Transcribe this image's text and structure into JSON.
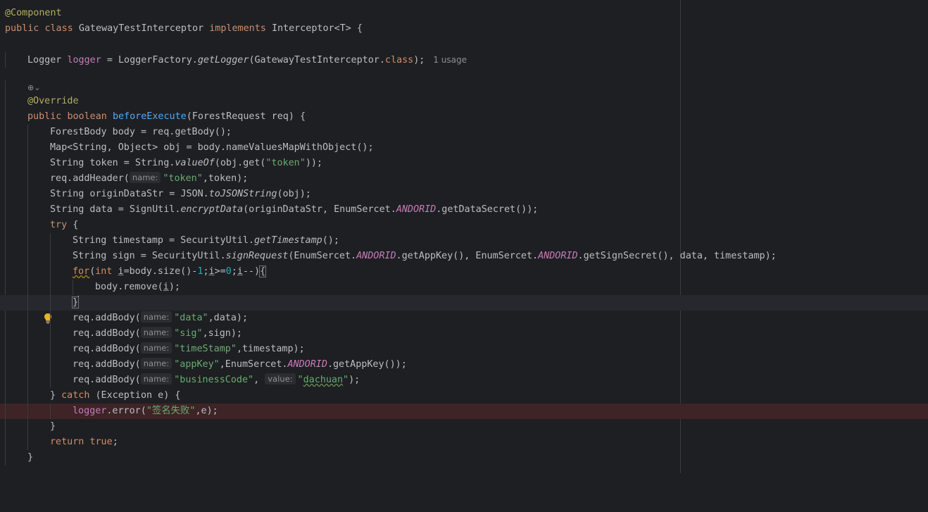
{
  "editor": {
    "annotation_component": "@Component",
    "class_decl": {
      "kw_public": "public",
      "kw_class": "class",
      "name": "GatewayTestInterceptor",
      "kw_implements": "implements",
      "iface": "Interceptor<T> {"
    },
    "logger_line": {
      "type": "Logger",
      "var": "logger",
      "eq": " = LoggerFactory.",
      "method": "getLogger",
      "arg": "(GatewayTestInterceptor.",
      "kw_class": "class",
      "end": ");",
      "usage": "1 usage"
    },
    "inherit_icon": "⊕⌄",
    "override": "@Override",
    "method_decl": {
      "kw_public": "public",
      "kw_boolean": "boolean",
      "name": "beforeExecute",
      "params": "(ForestRequest req) {"
    },
    "l_body": "ForestBody body = req.getBody();",
    "l_map": "Map<String, Object> obj = body.nameValuesMapWithObject();",
    "l_token": {
      "a": "String token = String.",
      "m": "valueOf",
      "b": "(obj.get(",
      "s": "\"token\"",
      "c": "));"
    },
    "l_header": {
      "a": "req.addHeader(",
      "hint": "name:",
      "s": "\"token\"",
      "c": ",token);"
    },
    "l_origin": {
      "a": "String originDataStr = JSON.",
      "m": "toJSONString",
      "c": "(obj);"
    },
    "l_data": {
      "a": "String data = SignUtil.",
      "m": "encryptData",
      "b": "(originDataStr, EnumSercet.",
      "f": "ANDORID",
      "c": ".getDataSecret());"
    },
    "kw_try": "try",
    "try_brace": " {",
    "l_ts": {
      "a": "String timestamp = SecurityUtil.",
      "m": "getTimestamp",
      "c": "();"
    },
    "l_sign": {
      "a": "String sign = SecurityUtil.",
      "m": "signRequest",
      "b": "(EnumSercet.",
      "f1": "ANDORID",
      "c": ".getAppKey(), EnumSercet.",
      "f2": "ANDORID",
      "d": ".getSignSecret(), data, timestamp);"
    },
    "l_for": {
      "kw_for": "for",
      "p1": "(",
      "kw_int": "int",
      "sp": " ",
      "i1": "i",
      "p2": "=body.size()-",
      "n1": "1",
      "p3": ";",
      "i2": "i",
      "p4": ">=",
      "n2": "0",
      "p5": ";",
      "i3": "i",
      "p6": "--)",
      "brace": "{"
    },
    "l_remove": {
      "a": "body.remove(",
      "i": "i",
      "c": ");"
    },
    "close_brace": "}",
    "l_ab1": {
      "a": "req.addBody(",
      "hint": "name:",
      "s": "\"data\"",
      "c": ",data);"
    },
    "l_ab2": {
      "a": "req.addBody(",
      "hint": "name:",
      "s": "\"sig\"",
      "c": ",sign);"
    },
    "l_ab3": {
      "a": "req.addBody(",
      "hint": "name:",
      "s": "\"timeStamp\"",
      "c": ",timestamp);"
    },
    "l_ab4": {
      "a": "req.addBody(",
      "hint": "name:",
      "s": "\"appKey\"",
      "c": ",EnumSercet.",
      "f": "ANDORID",
      "d": ".getAppKey());"
    },
    "l_ab5": {
      "a": "req.addBody(",
      "hint": "name:",
      "s": "\"businessCode\"",
      "c": ", ",
      "hint2": "value:",
      "q1": "\"",
      "s2": "dachuan",
      "q2": "\"",
      "d": ");"
    },
    "l_catch": {
      "a": "} ",
      "kw": "catch",
      "c": " (Exception e) {"
    },
    "l_err": {
      "f": "logger",
      "a": ".error(",
      "s": "\"签名失败\"",
      "c": ",e);"
    },
    "l_return": {
      "kw": "return",
      "sp": " ",
      "kw2": "true",
      "c": ";"
    },
    "end_brace": "}"
  }
}
